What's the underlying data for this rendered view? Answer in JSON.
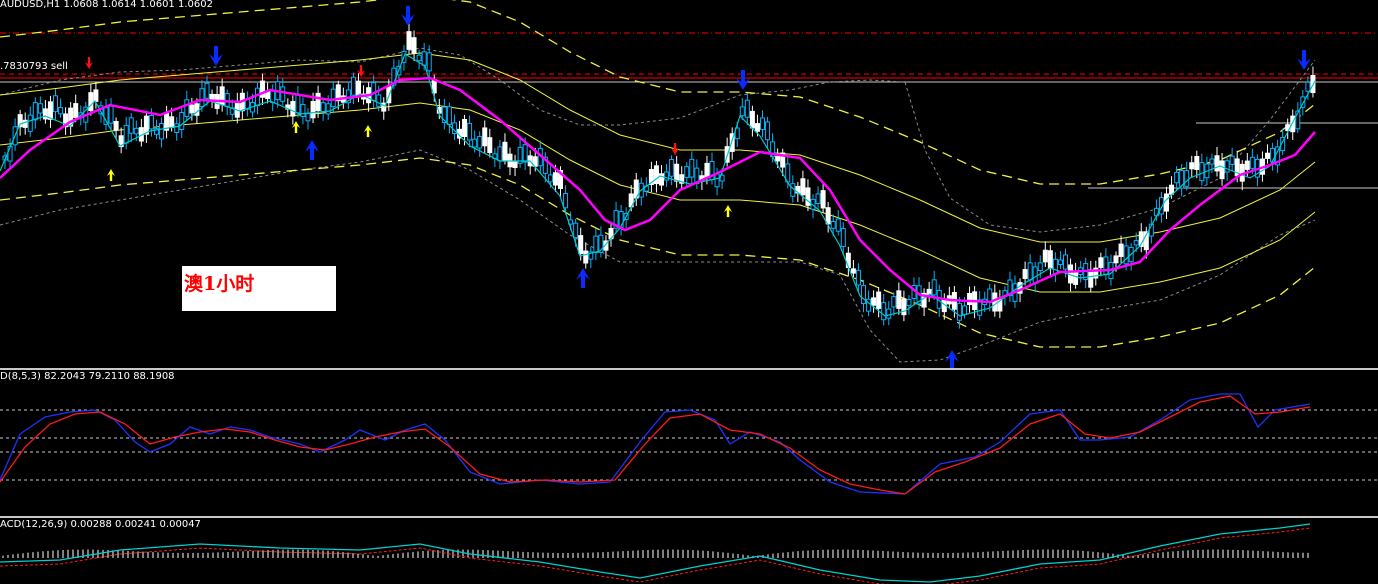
{
  "main_chart": {
    "header": "AUDUSD,H1  1.0608 1.0614 1.0601 1.0602",
    "order_label": ".7830793 sell",
    "annotation": "澳1小时",
    "colors": {
      "background": "#000000",
      "bull_body": "#000000",
      "bear_body": "#ffffff",
      "bull_outline": "#00b4ff",
      "ma_fast": "#00c8c8",
      "ma_slow": "#ff00ff",
      "envelope_inner": "#f0f040",
      "envelope_outer": "#f0f040",
      "bollinger": "#8a8a8a",
      "resistance_line": "#ff0000",
      "arrow_up_large": "#0a2aff",
      "arrow_up_small": "#ffff00",
      "arrow_down_small": "#ff1010"
    }
  },
  "stochastic": {
    "header": "D(8,5,3) 82.2043 79.2110 88.1908",
    "colors": {
      "main": "#1e32ff",
      "signal": "#ff1a1a",
      "levels": "#c8c8c8"
    }
  },
  "macd": {
    "header": "ACD(12,26,9) 0.00288 0.00241 0.00047",
    "colors": {
      "histogram": "#ffffff",
      "signal": "#ff1a1a",
      "main": "#00d0d0"
    }
  }
}
